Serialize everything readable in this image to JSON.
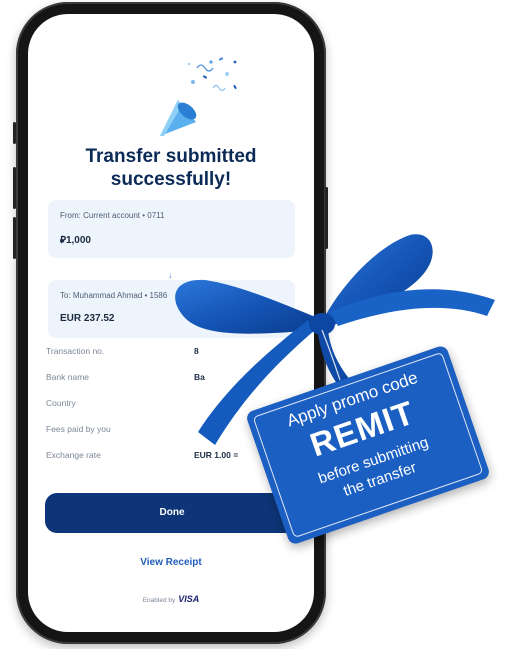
{
  "confirmation": {
    "title_line1": "Transfer submitted",
    "title_line2": "successfully!"
  },
  "from_card": {
    "label": "From: Current account • 0711",
    "amount": "⃃1,000"
  },
  "arrow_icon": "arrow-down-icon",
  "to_card": {
    "label": "To: Muhammad Ahmad • 1586",
    "amount": "EUR 237.52"
  },
  "details": [
    {
      "label": "Transaction no.",
      "value": "8"
    },
    {
      "label": "Bank name",
      "value": "Ba"
    },
    {
      "label": "Country",
      "value": ""
    },
    {
      "label": "Fees paid by you",
      "value": ""
    },
    {
      "label": "Exchange rate",
      "value": "EUR 1.00 ="
    }
  ],
  "actions": {
    "done_label": "Done",
    "receipt_label": "View Receipt"
  },
  "footer": {
    "enabled_by": "Enabled by",
    "brand": "VISA"
  },
  "promo_tag": {
    "line1": "Apply promo code",
    "code": "REMIT",
    "line3": "before submitting",
    "line4": "the transfer"
  },
  "colors": {
    "primary": "#0d3577",
    "accent": "#1f5db8",
    "ribbon": "#1c5fc2"
  }
}
